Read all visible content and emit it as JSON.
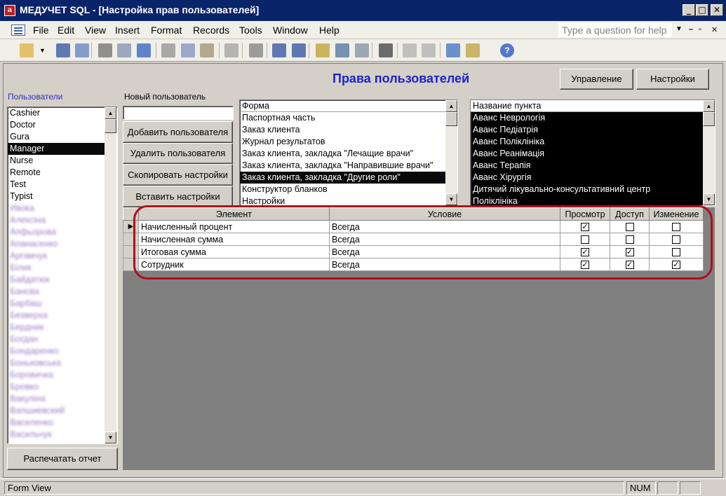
{
  "window": {
    "title": "МЕДУЧЕТ SQL - [Настройка прав пользователей]",
    "app_icon": "access-app-icon"
  },
  "menu": {
    "items": [
      "File",
      "Edit",
      "View",
      "Insert",
      "Format",
      "Records",
      "Tools",
      "Window",
      "Help"
    ],
    "question_placeholder": "Type a question for help"
  },
  "form": {
    "heading": "Права пользователей",
    "manage_button": "Управление",
    "settings_button": "Настройки",
    "users_label": "Пользователи",
    "new_user_label": "Новый пользователь",
    "new_user_value": "",
    "add_button": "Добавить пользователя",
    "delete_button": "Удалить пользователя",
    "copy_button": "Скопировать настройки",
    "paste_button": "Вставить настройки",
    "print_button": "Распечатать отчет"
  },
  "users": {
    "visible": [
      "Cashier",
      "Doctor",
      "Gura",
      "Manager",
      "Nurse",
      "Remote",
      "Test",
      "Typist"
    ],
    "selected": "Manager",
    "blurred": [
      "Ивока",
      "Алексіна",
      "Апфьорова",
      "Апанасенко",
      "Аргамчук",
      "Білик",
      "Байдатюк",
      "Бансва",
      "Барбаш",
      "Безверха",
      "Бердник",
      "Богдан",
      "Бондаренко",
      "Боньковська",
      "Боровичка",
      "Бровко",
      "Вакуліна",
      "Вапшиевский",
      "Василенко",
      "Васильчук"
    ]
  },
  "forms_list": {
    "header": "Форма",
    "items": [
      "Паспортная часть",
      "Заказ клиента",
      "Журнал результатов",
      "Заказ клиента, закладка \"Лечащие врачи\"",
      "Заказ клиента, закладка \"Направившие врачи\"",
      "Заказ клиента, закладка \"Другие роли\"",
      "Конструктор бланков",
      "Настройки"
    ],
    "selected": "Заказ клиента, закладка \"Другие роли\""
  },
  "points_list": {
    "header": "Название пункта",
    "items": [
      "Аванс Неврологія",
      "Аванс Педіатрія",
      "Аванс Поліклініка",
      "Аванс Реанімація",
      "Аванс Терапія",
      "Аванс Хірургія",
      "Дитячий лікувально-консультативний центр",
      "Поліклініка"
    ]
  },
  "grid": {
    "columns": [
      "Элемент",
      "Условие",
      "Просмотр",
      "Доступ",
      "Изменение"
    ],
    "rows": [
      {
        "element": "Начисленный процент",
        "condition": "Всегда",
        "view": true,
        "access": false,
        "edit": false
      },
      {
        "element": "Начисленная сумма",
        "condition": "Всегда",
        "view": false,
        "access": false,
        "edit": false
      },
      {
        "element": "Итоговая сумма",
        "condition": "Всегда",
        "view": true,
        "access": true,
        "edit": false
      },
      {
        "element": "Сотрудник",
        "condition": "Всегда",
        "view": true,
        "access": true,
        "edit": true
      }
    ]
  },
  "status": {
    "view": "Form View",
    "num": "NUM"
  },
  "colors": {
    "title_bar": "#0a246a",
    "heading": "#1c24c8",
    "highlight_outline": "#b20d1c"
  }
}
